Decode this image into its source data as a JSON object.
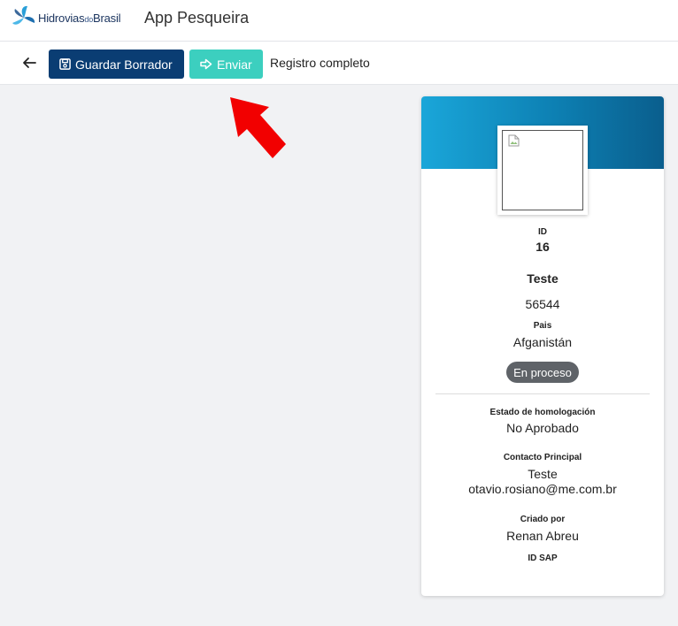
{
  "brand": {
    "logo_main": "Hidrovias",
    "logo_small": "do",
    "logo_end": "Brasil",
    "app_title": "App Pesqueira"
  },
  "toolbar": {
    "save_label": "Guardar Borrador",
    "send_label": "Enviar",
    "status": "Registro completo"
  },
  "colors": {
    "save_button": "#0a3d73",
    "send_button": "#3ccfbf",
    "header_start": "#1aa6d9",
    "header_end": "#0a5e8d",
    "badge": "#5f6368",
    "annotation_arrow": "#f20000"
  },
  "card": {
    "id_label": "ID",
    "id_value": "16",
    "name": "Teste",
    "code": "56544",
    "country_label": "Pais",
    "country_value": "Afganistán",
    "status_badge": "En proceso",
    "homologation_label": "Estado de homologación",
    "homologation_value": "No Aprobado",
    "contact_label": "Contacto Principal",
    "contact_name": "Teste",
    "contact_email": "otavio.rosiano@me.com.br",
    "created_label": "Criado por",
    "created_value": "Renan Abreu",
    "sap_label": "ID SAP"
  }
}
